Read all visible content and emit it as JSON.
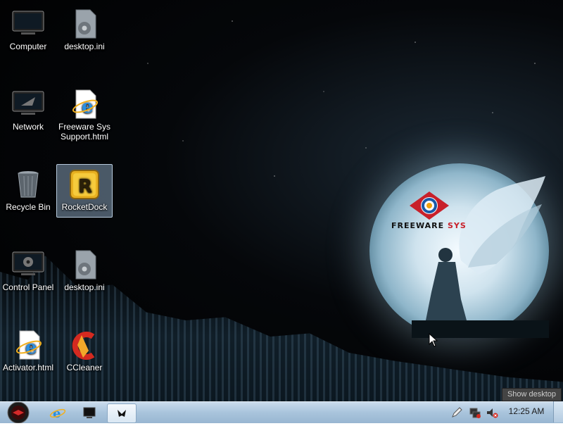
{
  "desktop": {
    "icons": [
      {
        "label": "Computer",
        "icon": "computer-icon"
      },
      {
        "label": "desktop.ini",
        "icon": "settings-file-icon"
      },
      {
        "label": "Network",
        "icon": "network-icon"
      },
      {
        "label": "Freeware Sys Support.html",
        "line1": "Freeware Sys",
        "line2": "Support.html",
        "icon": "ie-html-icon"
      },
      {
        "label": "Recycle Bin",
        "icon": "recycle-bin-icon"
      },
      {
        "label": "RocketDock",
        "icon": "rocketdock-icon"
      },
      {
        "label": "Control Panel",
        "icon": "control-panel-icon"
      },
      {
        "label": "desktop.ini",
        "icon": "settings-file-icon"
      },
      {
        "label": "Activator.html",
        "icon": "ie-html-icon"
      },
      {
        "label": "CCleaner",
        "icon": "ccleaner-icon"
      }
    ],
    "wallpaper": {
      "brand_main": "FREEWARE",
      "brand_accent": "SYS"
    }
  },
  "taskbar": {
    "clock": "12:25 AM",
    "tooltip": "Show desktop"
  },
  "colors": {
    "taskbar": "#a9c4dc",
    "brand_red": "#c8202a"
  }
}
